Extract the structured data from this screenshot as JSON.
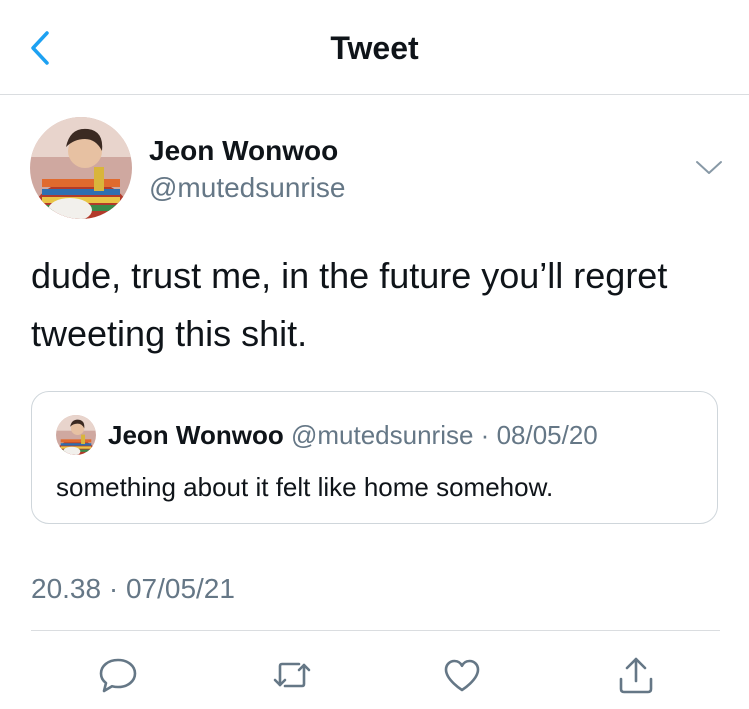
{
  "header": {
    "title": "Tweet",
    "back_icon": "chevron-left-icon"
  },
  "author": {
    "name": "Jeon Wonwoo",
    "handle": "@mutedsunrise"
  },
  "tweet": {
    "text": "dude, trust me, in the future you’ll regret tweeting this shit.",
    "timestamp": "20.38 · 07/05/21"
  },
  "quoted_tweet": {
    "name": "Jeon Wonwoo",
    "handle": "@mutedsunrise",
    "separator": " · ",
    "date": "08/05/20",
    "text": "something about it felt like home somehow."
  },
  "actions": {
    "reply_icon": "reply-icon",
    "retweet_icon": "retweet-icon",
    "like_icon": "heart-icon",
    "share_icon": "share-icon"
  },
  "colors": {
    "accent": "#1da1f2",
    "text_primary": "#0f1419",
    "text_secondary": "#657786",
    "border": "#dadde0"
  }
}
